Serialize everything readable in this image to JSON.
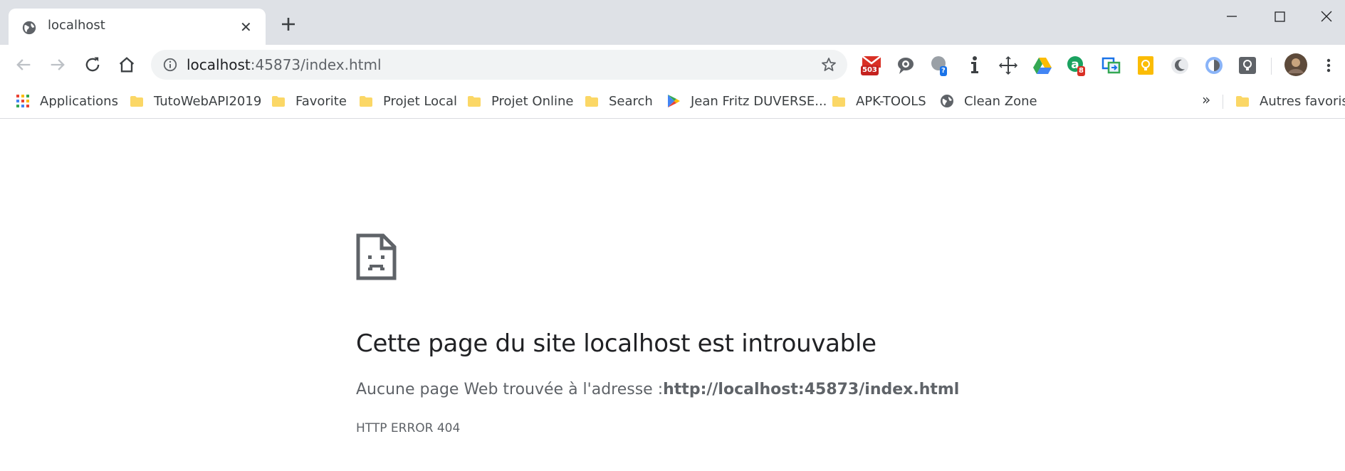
{
  "tab": {
    "title": "localhost",
    "close_glyph": "✕"
  },
  "omnibox": {
    "host": "localhost",
    "rest": ":45873/index.html"
  },
  "extensions": [
    {
      "name": "gmail-checker",
      "badge": "503",
      "badge_color": "#c5221f"
    },
    {
      "name": "comments"
    },
    {
      "name": "chat",
      "badge": "?",
      "badge_color": "#1a73e8"
    },
    {
      "name": "info"
    },
    {
      "name": "move"
    },
    {
      "name": "google-drive"
    },
    {
      "name": "a-ext",
      "badge": "8",
      "badge_color": "#d93025"
    },
    {
      "name": "screen-share"
    },
    {
      "name": "keep"
    },
    {
      "name": "dark-mode"
    },
    {
      "name": "dark-reader"
    },
    {
      "name": "bulb"
    },
    {
      "name": "profile-avatar"
    }
  ],
  "bookmarks": [
    {
      "label": "Applications",
      "icon": "apps-grid-icon"
    },
    {
      "label": "TutoWebAPI2019",
      "icon": "folder-icon"
    },
    {
      "label": "Favorite",
      "icon": "folder-icon"
    },
    {
      "label": "Projet Local",
      "icon": "folder-icon"
    },
    {
      "label": "Projet Online",
      "icon": "folder-icon"
    },
    {
      "label": "Search",
      "icon": "folder-icon"
    },
    {
      "label": "Jean Fritz DUVERSE...",
      "icon": "play-store-icon"
    },
    {
      "label": "APK-TOOLS",
      "icon": "folder-icon"
    },
    {
      "label": "Clean Zone",
      "icon": "globe-icon"
    }
  ],
  "bookmarks_overflow": "»",
  "other_bookmarks": "Autres favoris",
  "error": {
    "heading": "Cette page du site localhost est introuvable",
    "desc_prefix": "Aucune page Web trouvée à l'adresse :",
    "desc_url": "http://localhost:45873/index.html",
    "code": "HTTP ERROR 404"
  },
  "colors": {
    "tabstrip": "#dee1e6",
    "folder": "#fbd766",
    "text": "#202124",
    "muted": "#5f6368"
  }
}
